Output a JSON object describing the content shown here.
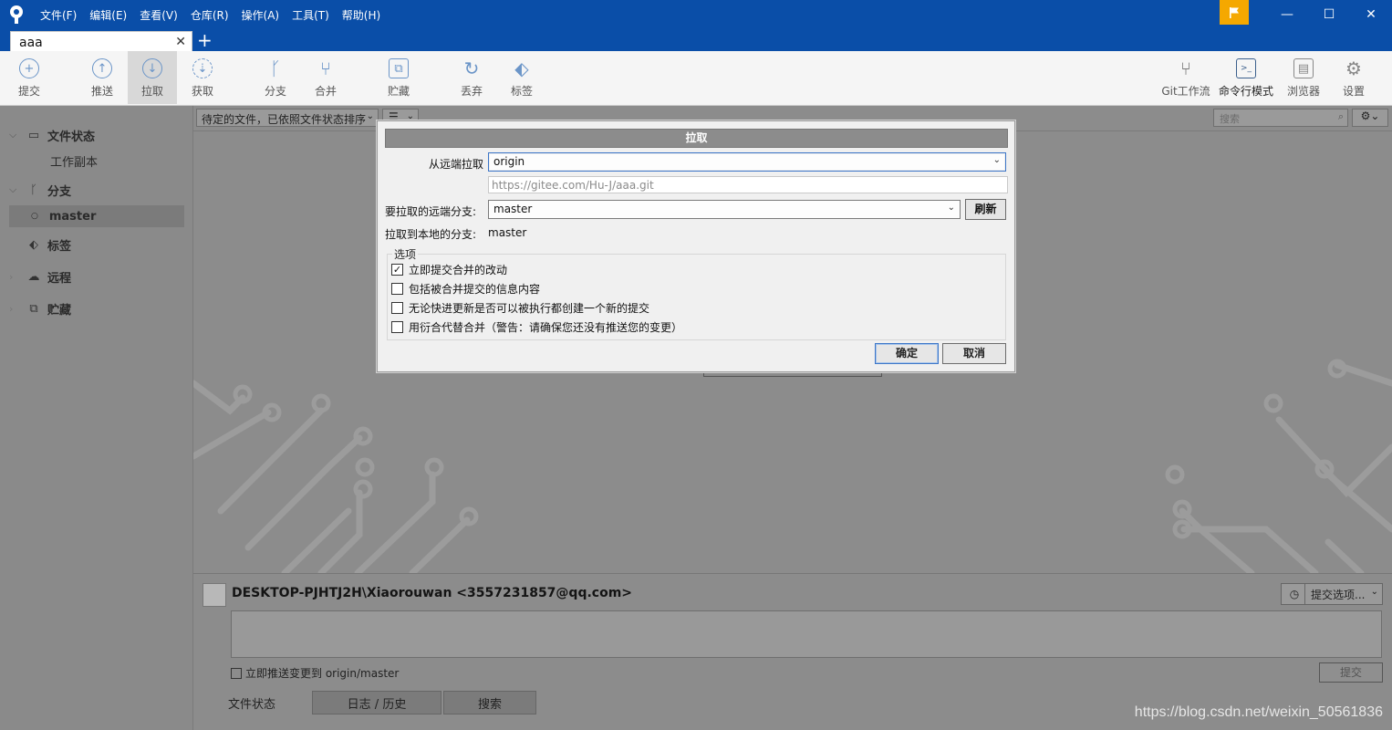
{
  "app": {
    "menu": [
      "文件(F)",
      "编辑(E)",
      "查看(V)",
      "仓库(R)",
      "操作(A)",
      "工具(T)",
      "帮助(H)"
    ],
    "window_controls": {
      "minimize": "—",
      "maximize": "☐",
      "close": "✕"
    },
    "accent": "#0a4ea8",
    "flag_color": "#f5a800"
  },
  "tab": {
    "title": "aaa",
    "close": "✕",
    "add": "+"
  },
  "toolbar": {
    "left": [
      {
        "label": "提交",
        "icon": "plus-circle-icon",
        "glyph": "+"
      },
      {
        "label": "推送",
        "icon": "arrow-up-circle-icon",
        "glyph": "↑"
      },
      {
        "label": "拉取",
        "icon": "arrow-down-circle-icon",
        "glyph": "↓"
      },
      {
        "label": "获取",
        "icon": "fetch-icon",
        "glyph": "⇣"
      },
      {
        "label": "分支",
        "icon": "branch-icon",
        "glyph": "ᚴ"
      },
      {
        "label": "合并",
        "icon": "merge-icon",
        "glyph": "⑂"
      },
      {
        "label": "贮藏",
        "icon": "stash-icon",
        "glyph": "⧉"
      },
      {
        "label": "丢弃",
        "icon": "discard-icon",
        "glyph": "↻"
      },
      {
        "label": "标签",
        "icon": "tag-icon",
        "glyph": "⬖"
      }
    ],
    "right": [
      {
        "label": "Git工作流",
        "icon": "git-flow-icon",
        "glyph": "⑂"
      },
      {
        "label": "命令行模式",
        "icon": "terminal-icon",
        "glyph": ">_"
      },
      {
        "label": "浏览器",
        "icon": "browser-icon",
        "glyph": "▤"
      },
      {
        "label": "设置",
        "icon": "gear-icon",
        "glyph": "⚙"
      }
    ]
  },
  "sidebar": {
    "file_status": "文件状态",
    "working_copy": "工作副本",
    "branches": "分支",
    "current_branch": "master",
    "tags": "标签",
    "remotes": "远程",
    "stashes": "贮藏"
  },
  "main": {
    "filter_label": "待定的文件，已依照文件状态排序",
    "search_placeholder": "搜索"
  },
  "commit": {
    "author": "DESKTOP-PJHTJ2H\\Xiaorouwan <3557231857@qq.com>",
    "options_label": "提交选项...",
    "push_immediately": "立即推送变更到 origin/master",
    "commit_button": "提交",
    "bottom_tabs": [
      "文件状态",
      "日志 / 历史",
      "搜索"
    ]
  },
  "dialog": {
    "title": "拉取",
    "remote_label": "从远端拉取",
    "remote_value": "origin",
    "remote_url": "https://gitee.com/Hu-J/aaa.git",
    "remote_branch_label": "要拉取的远端分支:",
    "remote_branch_value": "master",
    "refresh": "刷新",
    "local_branch_label": "拉取到本地的分支:",
    "local_branch_value": "master",
    "options_title": "选项",
    "options": [
      {
        "label": "立即提交合并的改动",
        "checked": true
      },
      {
        "label": "包括被合并提交的信息内容",
        "checked": false
      },
      {
        "label": "无论快进更新是否可以被执行都创建一个新的提交",
        "checked": false
      },
      {
        "label": "用衍合代替合并（警告：请确保您还没有推送您的变更）",
        "checked": false
      }
    ],
    "ok": "确定",
    "cancel": "取消"
  },
  "watermark": "https://blog.csdn.net/weixin_50561836"
}
